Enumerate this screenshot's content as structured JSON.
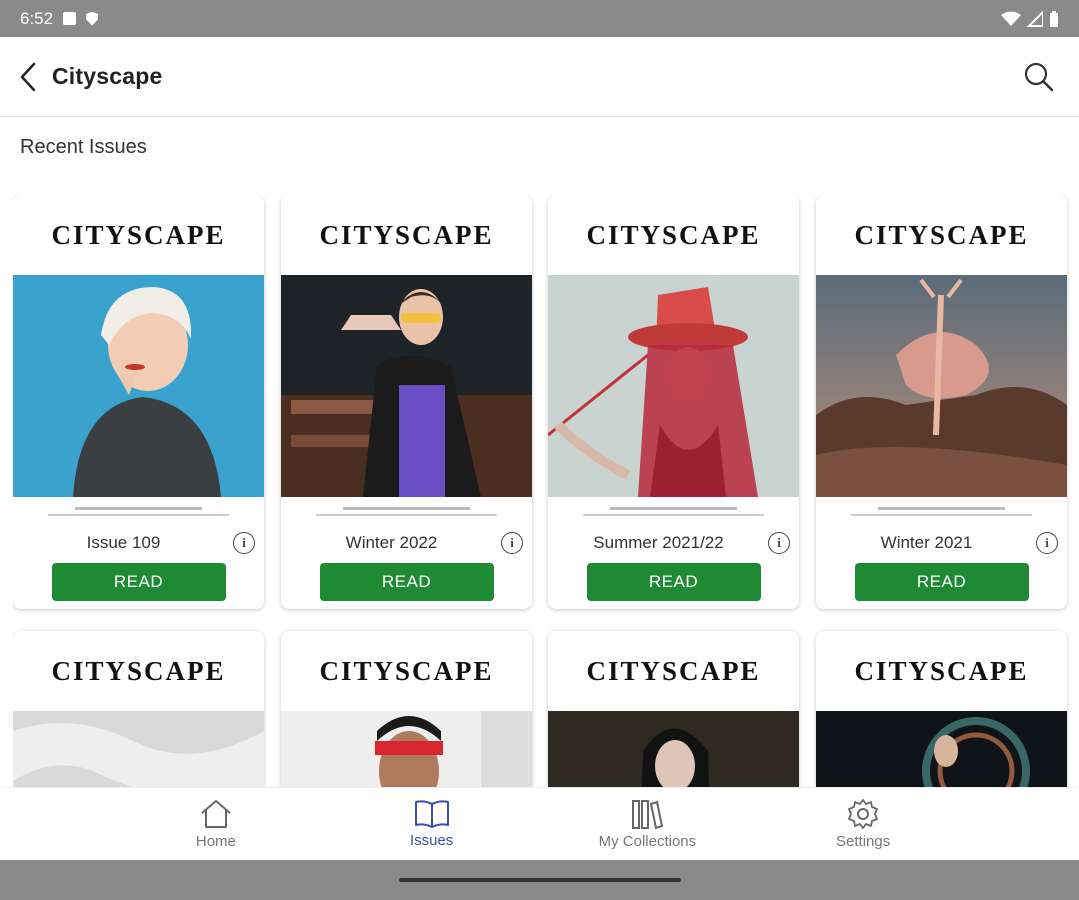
{
  "status_bar": {
    "time": "6:52"
  },
  "app_bar": {
    "title": "Cityscape"
  },
  "section": {
    "title": "Recent Issues"
  },
  "issues": [
    {
      "masthead": "CITYSCAPE",
      "name": "Issue 109",
      "action": "READ"
    },
    {
      "masthead": "CITYSCAPE",
      "name": "Winter 2022",
      "action": "READ"
    },
    {
      "masthead": "CITYSCAPE",
      "name": "Summer 2021/22",
      "action": "READ"
    },
    {
      "masthead": "CITYSCAPE",
      "name": "Winter 2021",
      "action": "READ"
    },
    {
      "masthead": "CITYSCAPE"
    },
    {
      "masthead": "CITYSCAPE"
    },
    {
      "masthead": "CITYSCAPE"
    },
    {
      "masthead": "CITYSCAPE"
    }
  ],
  "info_glyph": "i",
  "bottom_nav": [
    {
      "label": "Home",
      "icon": "home-icon",
      "active": false
    },
    {
      "label": "Issues",
      "icon": "book-icon",
      "active": true
    },
    {
      "label": "My Collections",
      "icon": "library-icon",
      "active": false
    },
    {
      "label": "Settings",
      "icon": "gear-icon",
      "active": false
    }
  ],
  "colors": {
    "accent": "#3a4fb5",
    "read_button": "#1f8a34",
    "system_bar": "#8a8a8a"
  }
}
